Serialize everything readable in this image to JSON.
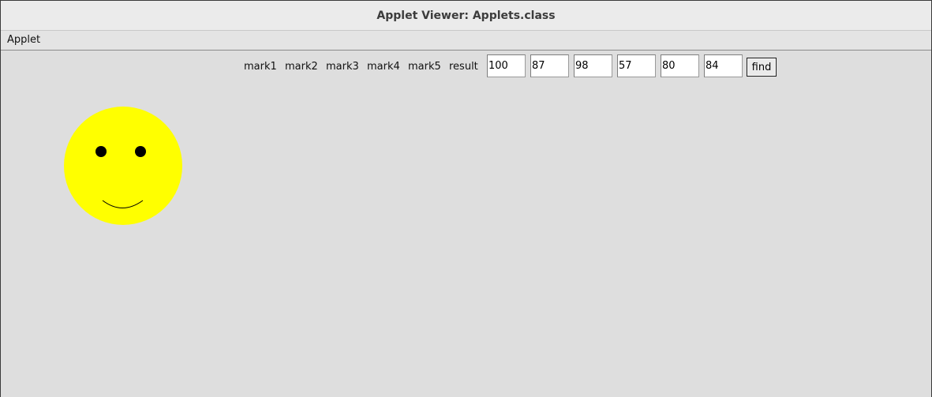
{
  "window": {
    "title": "Applet Viewer: Applets.class"
  },
  "menubar": {
    "items": [
      {
        "label": "Applet"
      }
    ]
  },
  "form": {
    "labels": [
      "mark1",
      "mark2",
      "mark3",
      "mark4",
      "mark5",
      "result"
    ],
    "fields": [
      "100",
      "87",
      "98",
      "57",
      "80",
      "84"
    ],
    "button_label": "find"
  },
  "smiley": {
    "face_color": "#ffff00",
    "feature_color": "#000000"
  }
}
